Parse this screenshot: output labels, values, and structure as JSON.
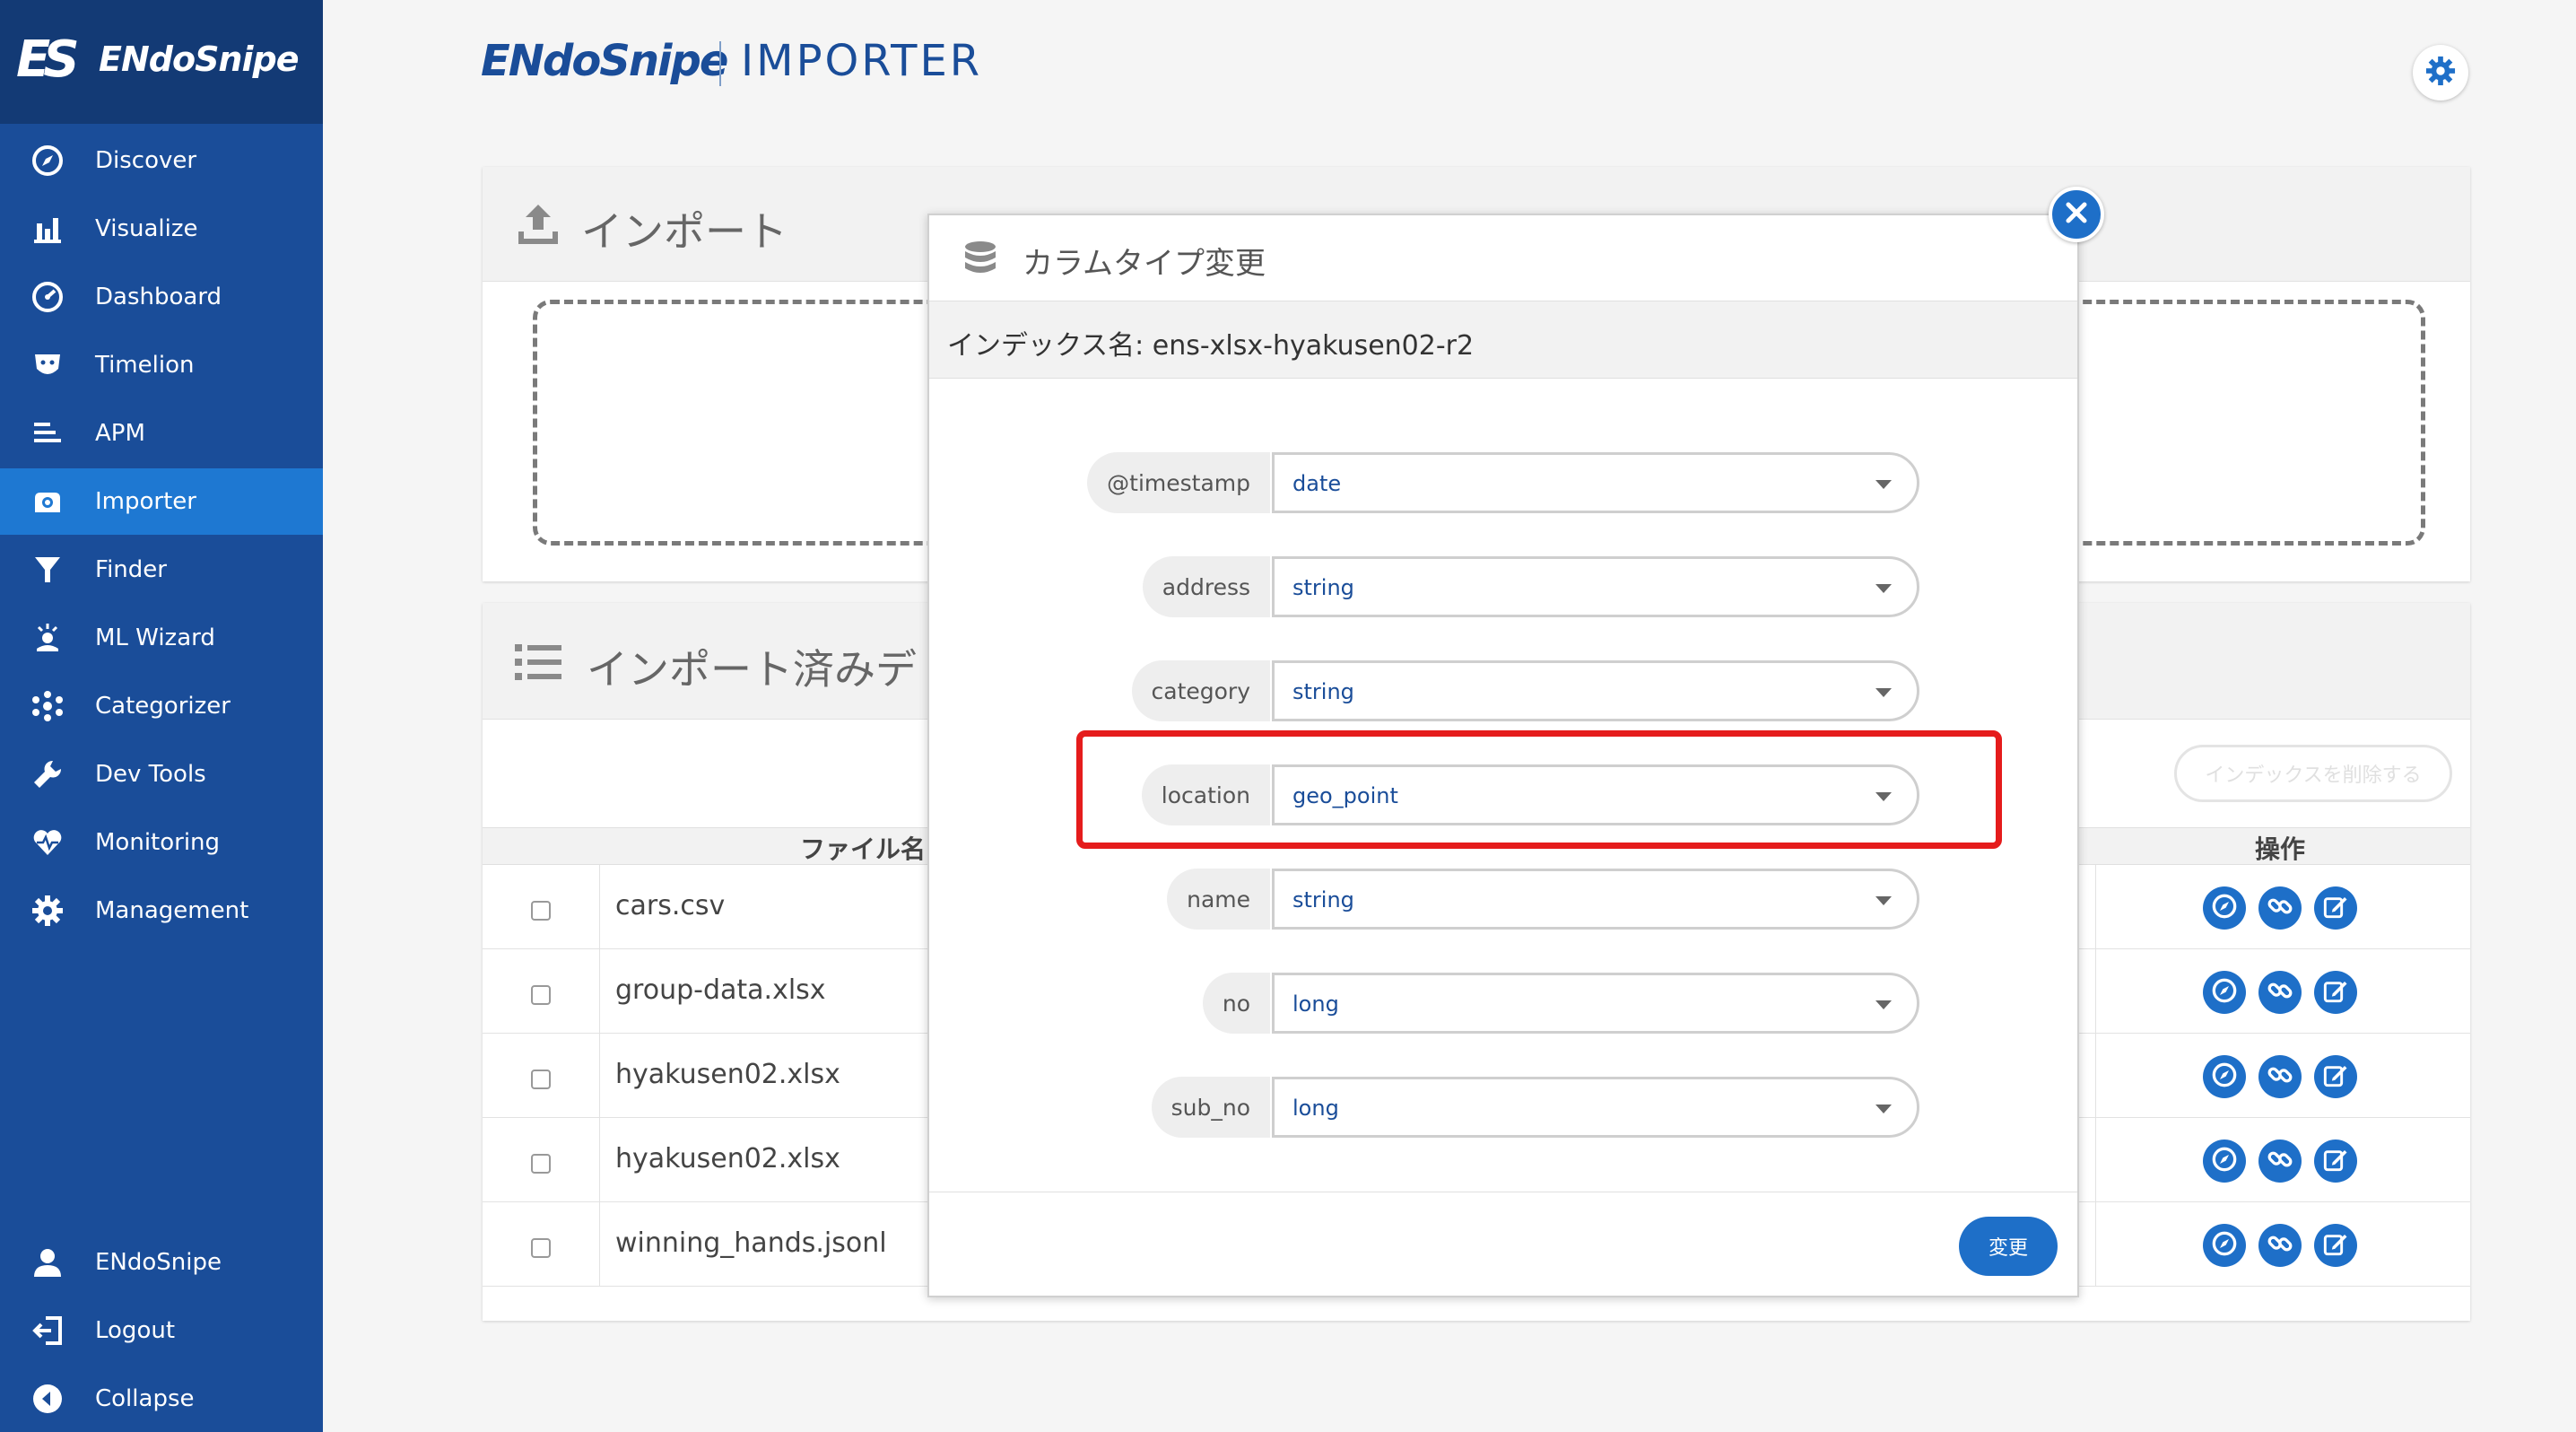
{
  "sidebar": {
    "logo_mark": "ES",
    "logo_text": "ENdoSnipe",
    "items": [
      {
        "label": "Discover",
        "icon": "compass-icon"
      },
      {
        "label": "Visualize",
        "icon": "bar-chart-icon"
      },
      {
        "label": "Dashboard",
        "icon": "dashboard-icon"
      },
      {
        "label": "Timelion",
        "icon": "timelion-icon"
      },
      {
        "label": "APM",
        "icon": "apm-icon"
      },
      {
        "label": "Importer",
        "icon": "importer-icon",
        "active": true
      },
      {
        "label": "Finder",
        "icon": "funnel-icon"
      },
      {
        "label": "ML Wizard",
        "icon": "ml-wizard-icon"
      },
      {
        "label": "Categorizer",
        "icon": "categorizer-icon"
      },
      {
        "label": "Dev Tools",
        "icon": "wrench-icon"
      },
      {
        "label": "Monitoring",
        "icon": "heartbeat-icon"
      },
      {
        "label": "Management",
        "icon": "gear-icon"
      }
    ],
    "bottom_items": [
      {
        "label": "ENdoSnipe",
        "icon": "user-icon"
      },
      {
        "label": "Logout",
        "icon": "logout-icon"
      },
      {
        "label": "Collapse",
        "icon": "collapse-icon"
      }
    ]
  },
  "header": {
    "brand": "ENdoSnipe",
    "product": "IMPORTER"
  },
  "import_panel": {
    "title": "インポート"
  },
  "imported_panel": {
    "title": "インポート済みデ",
    "delete_button": "インデックスを削除する",
    "columns": {
      "file": "ファイル名",
      "actions": "操作"
    },
    "rows": [
      {
        "file": "cars.csv"
      },
      {
        "file": "group-data.xlsx"
      },
      {
        "file": "hyakusen02.xlsx"
      },
      {
        "file": "hyakusen02.xlsx"
      },
      {
        "file": "winning_hands.jsonl"
      }
    ]
  },
  "modal": {
    "title": "カラムタイプ変更",
    "index_label": "インデックス名: ens-xlsx-hyakusen02-r2",
    "fields": [
      {
        "name": "@timestamp",
        "type": "date"
      },
      {
        "name": "address",
        "type": "string"
      },
      {
        "name": "category",
        "type": "string"
      },
      {
        "name": "location",
        "type": "geo_point"
      },
      {
        "name": "name",
        "type": "string"
      },
      {
        "name": "no",
        "type": "long"
      },
      {
        "name": "sub_no",
        "type": "long"
      }
    ],
    "submit": "変更"
  },
  "colors": {
    "sidebar": "#1a4d99",
    "sidebar_active": "#1e78d2",
    "accent": "#1e6fc8",
    "highlight": "#e51c1c"
  }
}
